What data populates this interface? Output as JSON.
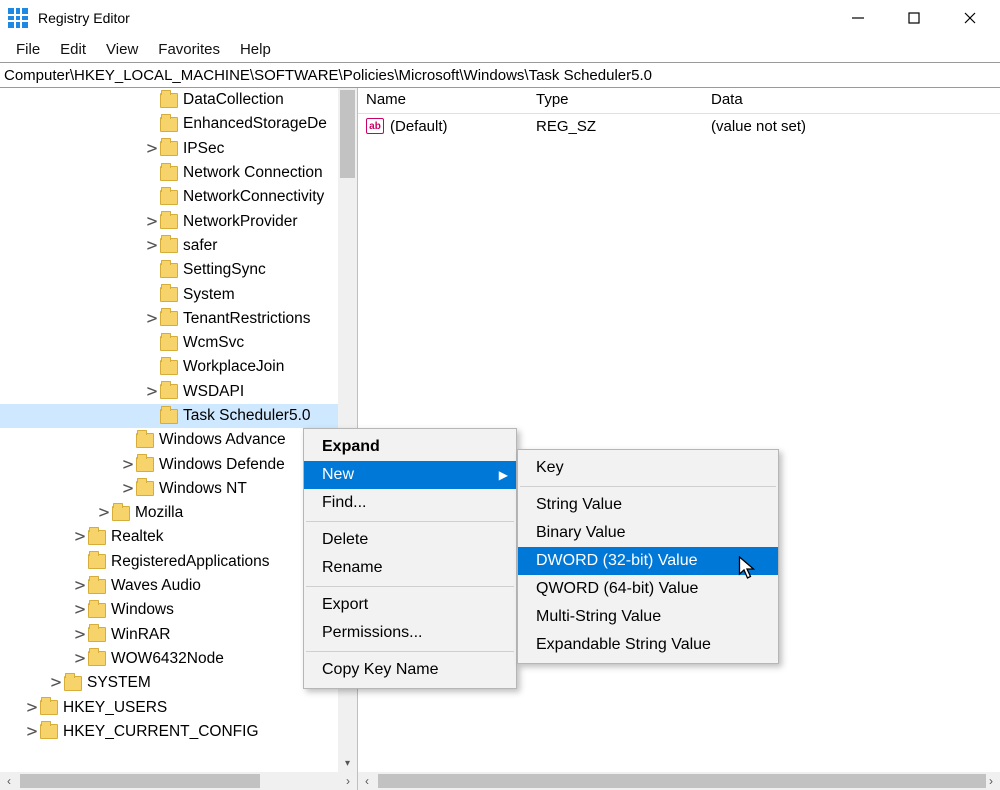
{
  "window": {
    "title": "Registry Editor"
  },
  "menu": [
    "File",
    "Edit",
    "View",
    "Favorites",
    "Help"
  ],
  "address": "Computer\\HKEY_LOCAL_MACHINE\\SOFTWARE\\Policies\\Microsoft\\Windows\\Task Scheduler5.0",
  "tree": [
    {
      "ind": 144,
      "tw": "",
      "label": "DataCollection"
    },
    {
      "ind": 144,
      "tw": "",
      "label": "EnhancedStorageDe"
    },
    {
      "ind": 144,
      "tw": ">",
      "label": "IPSec"
    },
    {
      "ind": 144,
      "tw": "",
      "label": "Network Connection"
    },
    {
      "ind": 144,
      "tw": "",
      "label": "NetworkConnectivity"
    },
    {
      "ind": 144,
      "tw": ">",
      "label": "NetworkProvider"
    },
    {
      "ind": 144,
      "tw": ">",
      "label": "safer"
    },
    {
      "ind": 144,
      "tw": "",
      "label": "SettingSync"
    },
    {
      "ind": 144,
      "tw": "",
      "label": "System"
    },
    {
      "ind": 144,
      "tw": ">",
      "label": "TenantRestrictions"
    },
    {
      "ind": 144,
      "tw": "",
      "label": "WcmSvc"
    },
    {
      "ind": 144,
      "tw": "",
      "label": "WorkplaceJoin"
    },
    {
      "ind": 144,
      "tw": ">",
      "label": "WSDAPI"
    },
    {
      "ind": 144,
      "tw": "",
      "label": "Task Scheduler5.0",
      "selected": true
    },
    {
      "ind": 120,
      "tw": "",
      "label": "Windows Advance"
    },
    {
      "ind": 120,
      "tw": ">",
      "label": "Windows Defende"
    },
    {
      "ind": 120,
      "tw": ">",
      "label": "Windows NT"
    },
    {
      "ind": 96,
      "tw": ">",
      "label": "Mozilla"
    },
    {
      "ind": 72,
      "tw": ">",
      "label": "Realtek"
    },
    {
      "ind": 72,
      "tw": "",
      "label": "RegisteredApplications"
    },
    {
      "ind": 72,
      "tw": ">",
      "label": "Waves Audio"
    },
    {
      "ind": 72,
      "tw": ">",
      "label": "Windows"
    },
    {
      "ind": 72,
      "tw": ">",
      "label": "WinRAR"
    },
    {
      "ind": 72,
      "tw": ">",
      "label": "WOW6432Node"
    },
    {
      "ind": 48,
      "tw": ">",
      "label": "SYSTEM"
    },
    {
      "ind": 24,
      "tw": ">",
      "label": "HKEY_USERS"
    },
    {
      "ind": 24,
      "tw": ">",
      "label": "HKEY_CURRENT_CONFIG"
    }
  ],
  "list": {
    "headers": {
      "name": "Name",
      "type": "Type",
      "data": "Data"
    },
    "rows": [
      {
        "icon": "ab",
        "name": "(Default)",
        "type": "REG_SZ",
        "data": "(value not set)"
      }
    ]
  },
  "context_menu_1": {
    "expand": "Expand",
    "new": "New",
    "find": "Find...",
    "delete": "Delete",
    "rename": "Rename",
    "export": "Export",
    "permissions": "Permissions...",
    "copy_key": "Copy Key Name"
  },
  "context_menu_2": {
    "key": "Key",
    "string": "String Value",
    "binary": "Binary Value",
    "dword": "DWORD (32-bit) Value",
    "qword": "QWORD (64-bit) Value",
    "multi": "Multi-String Value",
    "expand": "Expandable String Value"
  }
}
